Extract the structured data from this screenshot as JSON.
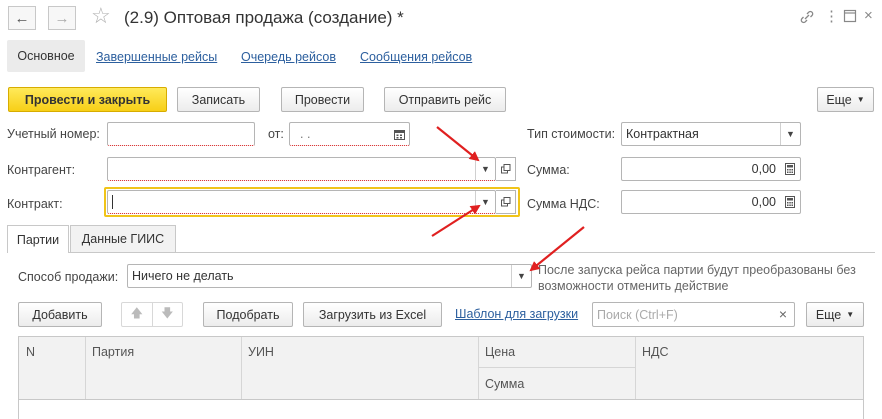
{
  "window": {
    "title": "(2.9) Оптовая продажа (создание) *"
  },
  "nav": {
    "tabs": [
      {
        "label": "Основное"
      },
      {
        "label": "Завершенные рейсы"
      },
      {
        "label": "Очередь рейсов"
      },
      {
        "label": "Сообщения рейсов"
      }
    ]
  },
  "toolbar": {
    "post_close": "Провести и закрыть",
    "save": "Записать",
    "post": "Провести",
    "send_trip": "Отправить рейс",
    "more": "Еще"
  },
  "form": {
    "account_number_label": "Учетный номер:",
    "account_number_value": "",
    "from_label": "от:",
    "date_value": " .  .",
    "counterparty_label": "Контрагент:",
    "counterparty_value": "",
    "contract_label": "Контракт:",
    "contract_value": "",
    "cost_type_label": "Тип стоимости:",
    "cost_type_value": "Контрактная",
    "sum_label": "Сумма:",
    "sum_value": "0,00",
    "vat_sum_label": "Сумма НДС:",
    "vat_sum_value": "0,00"
  },
  "subtabs": [
    {
      "label": "Партии"
    },
    {
      "label": "Данные ГИИС"
    }
  ],
  "lots": {
    "sale_method_label": "Способ продажи:",
    "sale_method_value": "Ничего не делать",
    "hint": "После запуска рейса партии будут преобразованы без возможности отменить действие",
    "add": "Добавить",
    "pick": "Подобрать",
    "load_excel": "Загрузить из Excel",
    "template_link": "Шаблон для загрузки",
    "search_placeholder": "Поиск (Ctrl+F)",
    "search_value": "",
    "more": "Еще"
  },
  "table": {
    "columns": {
      "n": "N",
      "lot": "Партия",
      "uin": "УИН",
      "price": "Цена",
      "sum": "Сумма",
      "vat": "НДС"
    }
  },
  "colors": {
    "accent_yellow": "#f7cf17",
    "link": "#2c5f9e",
    "arrow_red": "#e02020",
    "focus_border": "#f0c419"
  },
  "icons": {
    "back": "arrow-left-icon",
    "forward": "arrow-right-icon",
    "favorite": "star-icon",
    "link": "link-icon",
    "menu": "kebab-icon",
    "maximize": "maximize-icon",
    "close": "close-icon",
    "calendar": "calendar-icon",
    "calculator": "calculator-icon",
    "open": "open-window-icon"
  }
}
